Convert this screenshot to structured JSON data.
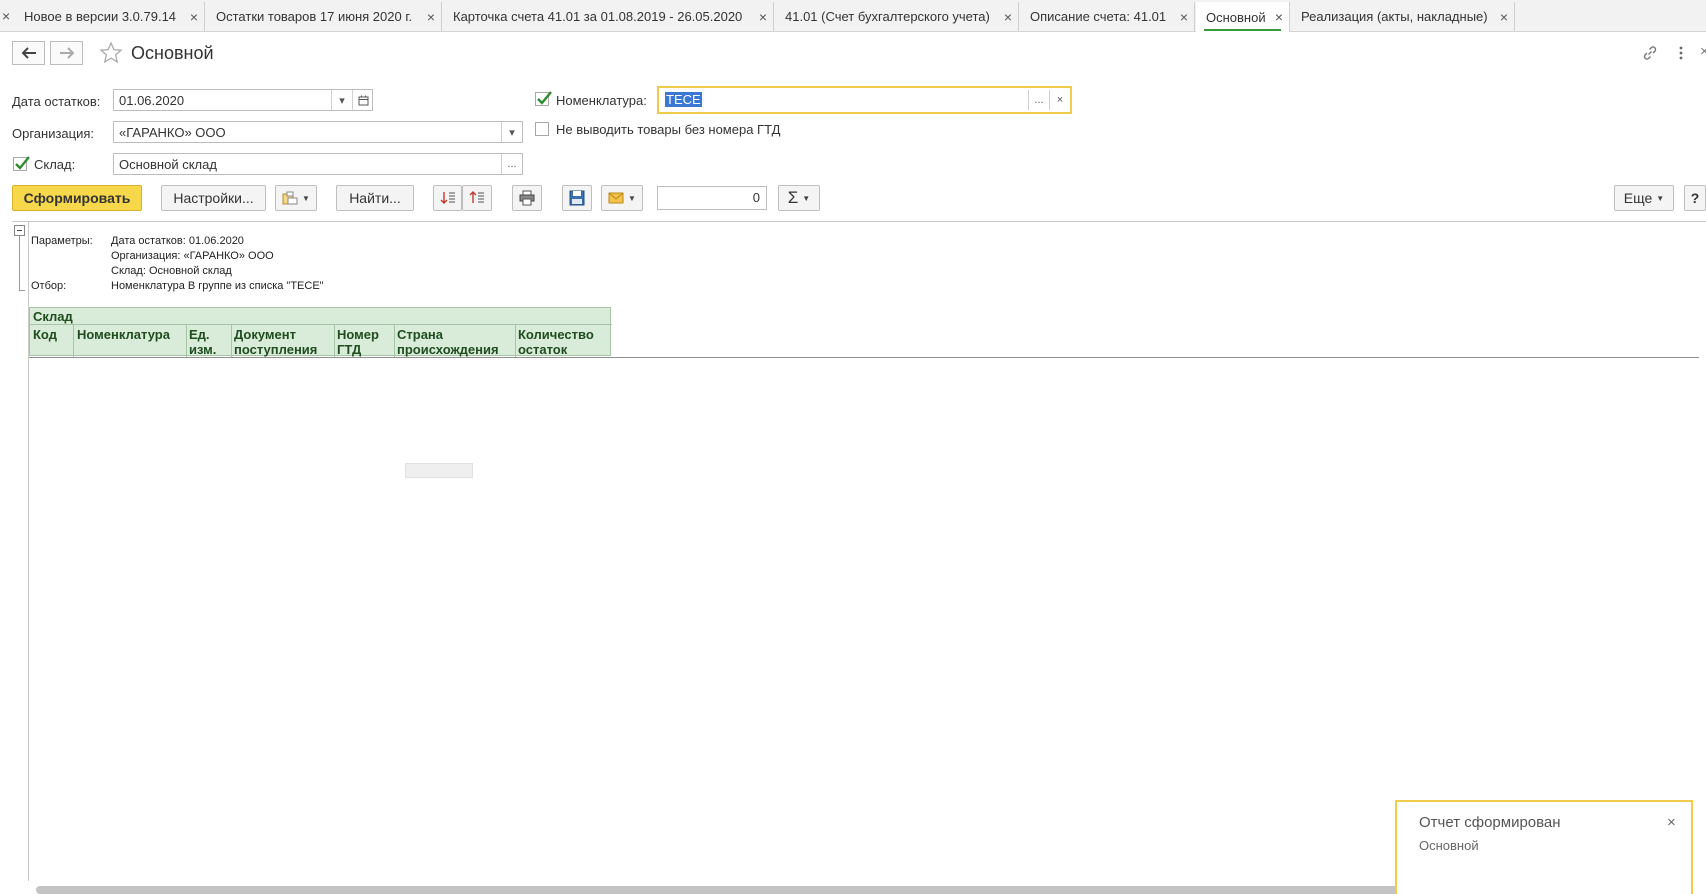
{
  "tabs": [
    {
      "label": "Новое в версии 3.0.79.14"
    },
    {
      "label": "Остатки товаров 17 июня 2020 г."
    },
    {
      "label": "Карточка счета 41.01 за 01.08.2019 - 26.05.2020"
    },
    {
      "label": "41.01 (Счет бухгалтерского учета)"
    },
    {
      "label": "Описание счета: 41.01"
    },
    {
      "label": "Основной",
      "active": true
    },
    {
      "label": "Реализация (акты, накладные)"
    }
  ],
  "header": {
    "title": "Основной"
  },
  "form": {
    "date_label": "Дата остатков:",
    "date_value": "01.06.2020",
    "org_label": "Организация:",
    "org_value": "«ГАРАНКО» ООО",
    "warehouse_label": "Склад:",
    "warehouse_value": "Основной склад",
    "warehouse_checked": true,
    "nomenclature_label": "Номенклатура:",
    "nomenclature_value": "ТЕСЕ",
    "nomenclature_checked": true,
    "no_gtd_label": "Не выводить товары без номера ГТД",
    "no_gtd_checked": false
  },
  "toolbar": {
    "generate_label": "Сформировать",
    "settings_label": "Настройки...",
    "find_label": "Найти...",
    "sum_value": "0",
    "sigma": "Σ",
    "more_label": "Еще",
    "help_label": "?"
  },
  "report": {
    "params_caption": "Параметры:",
    "params_lines": [
      "Дата остатков: 01.06.2020",
      "Организация: «ГАРАНКО» ООО",
      "Склад: Основной склад"
    ],
    "filter_caption": "Отбор:",
    "filter_value": "Номенклатура В группе из списка \"ТЕСЕ\"",
    "group_header": "Склад",
    "columns": [
      "Код",
      "Номенклатура",
      "Ед. изм.",
      "Документ поступления",
      "Номер ГТД",
      "Страна происхождения",
      "Количество остаток"
    ]
  },
  "notification": {
    "title": "Отчет сформирован",
    "subtitle": "Основной"
  },
  "colors": {
    "accent_green": "#3a9b3a",
    "primary_yellow": "#f6d84a",
    "header_green": "#d9ebd9"
  }
}
